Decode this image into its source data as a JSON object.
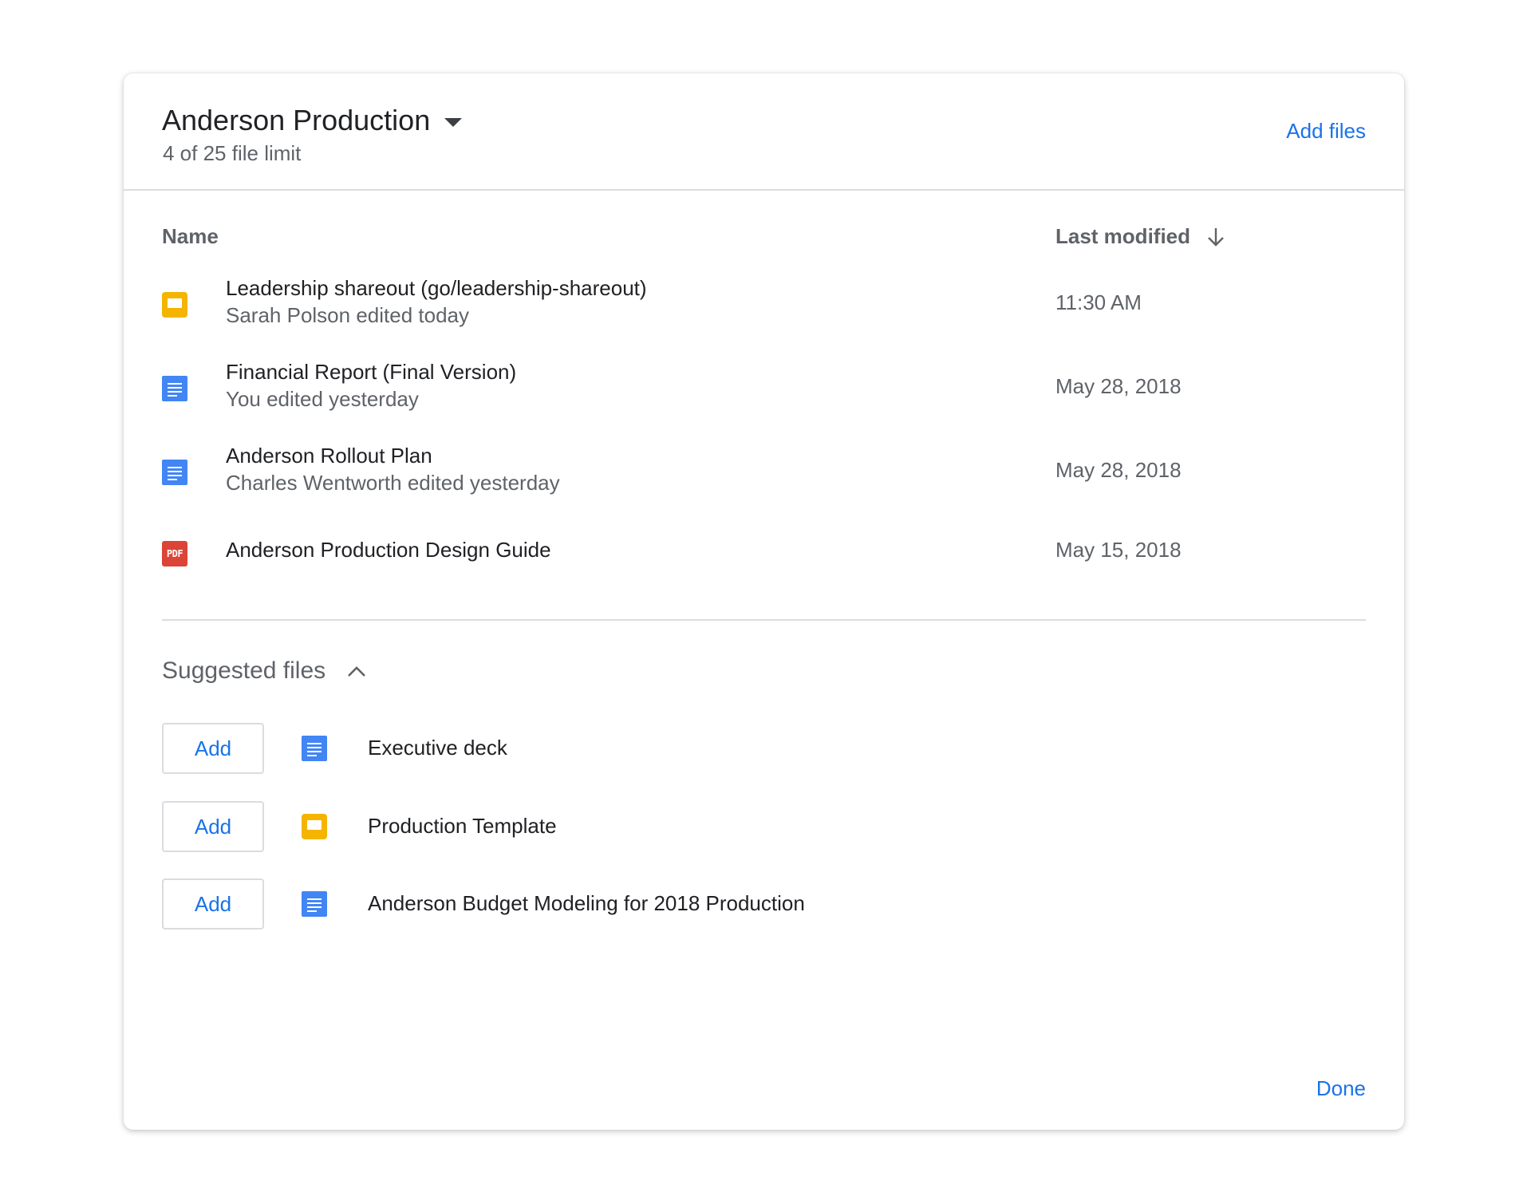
{
  "header": {
    "title": "Anderson Production",
    "subtitle": "4 of 25 file limit",
    "add_files_label": "Add files"
  },
  "columns": {
    "name": "Name",
    "last_modified": "Last modified"
  },
  "files": [
    {
      "name": "Leadership shareout (go/leadership-shareout)",
      "subtitle": "Sarah Polson edited today",
      "date": "11:30 AM",
      "icon": "slides-icon"
    },
    {
      "name": "Financial Report (Final Version)",
      "subtitle": "You edited yesterday",
      "date": "May 28, 2018",
      "icon": "docs-icon"
    },
    {
      "name": "Anderson Rollout Plan",
      "subtitle": "Charles Wentworth edited yesterday",
      "date": "May 28, 2018",
      "icon": "docs-icon"
    },
    {
      "name": "Anderson Production Design Guide",
      "subtitle": "",
      "date": "May 15, 2018",
      "icon": "pdf-icon",
      "icon_text": "PDF"
    }
  ],
  "suggested": {
    "title": "Suggested files",
    "add_label": "Add",
    "items": [
      {
        "name": "Executive deck",
        "icon": "docs-icon"
      },
      {
        "name": "Production Template",
        "icon": "slides-icon"
      },
      {
        "name": "Anderson Budget Modeling for 2018 Production",
        "icon": "docs-icon"
      }
    ]
  },
  "footer": {
    "done_label": "Done"
  },
  "colors": {
    "accent": "#1a73e8",
    "slides": "#f4b400",
    "docs": "#4285f4",
    "pdf": "#db4437"
  }
}
